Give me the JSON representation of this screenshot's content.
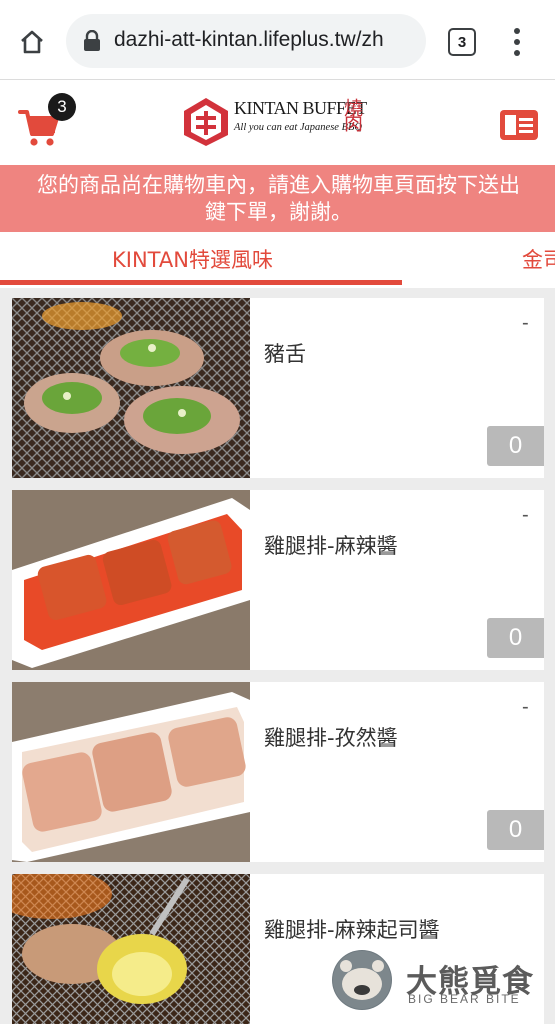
{
  "browser": {
    "url": "dazhi-att-kintan.lifeplus.tw/zh",
    "tab_count": "3"
  },
  "header": {
    "cart_count": "3",
    "logo_main": "KINTAN BUFFET",
    "logo_sub": "All you can eat Japanese BBQ",
    "logo_kanji": "燒肉"
  },
  "notice": {
    "line1": "您的商品尚在購物車內，請進入購物車頁面按下送出",
    "line2": "鍵下單，謝謝。"
  },
  "categories": {
    "active": "KINTAN特選風味",
    "next": "金司"
  },
  "products": [
    {
      "name": "豬舌",
      "price": "-",
      "qty": "0"
    },
    {
      "name": "雞腿排-麻辣醬",
      "price": "-",
      "qty": "0"
    },
    {
      "name": "雞腿排-孜然醬",
      "price": "-",
      "qty": "0"
    },
    {
      "name": "雞腿排-麻辣起司醬",
      "price": "-",
      "qty": ""
    }
  ],
  "watermark": {
    "title": "大熊覓食",
    "subtitle": "BIG BEAR BITE"
  },
  "colors": {
    "brand_red": "#e24a3c",
    "notice_bg": "#ef8480",
    "qty_bg": "#b9b9b9"
  }
}
